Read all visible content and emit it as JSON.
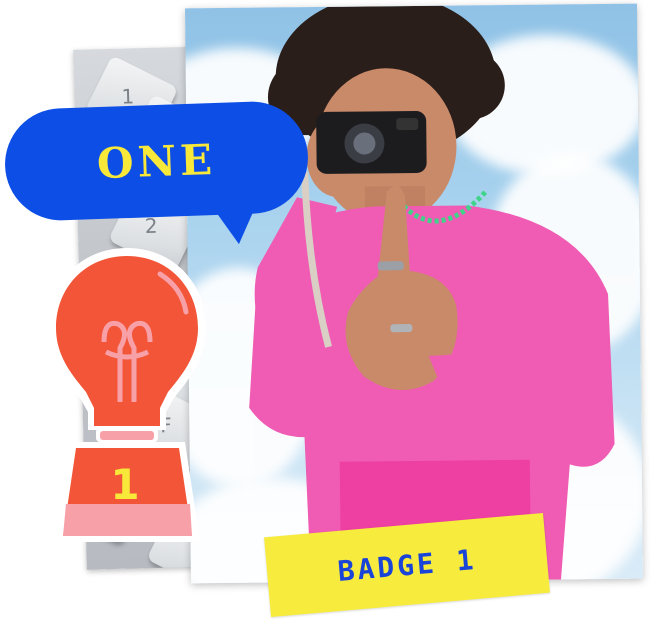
{
  "speech_bubble": {
    "text": "ONE",
    "color": "#0d4fe6",
    "text_color": "#f7e83a"
  },
  "keyboard": {
    "keys": [
      "1",
      "2",
      "F"
    ]
  },
  "lightbulb": {
    "number": "1",
    "color": "#f25537",
    "accent": "#f8a0a8"
  },
  "badge": {
    "text": "BADGE 1",
    "color": "#f7ec3d",
    "text_color": "#1a43d8"
  }
}
